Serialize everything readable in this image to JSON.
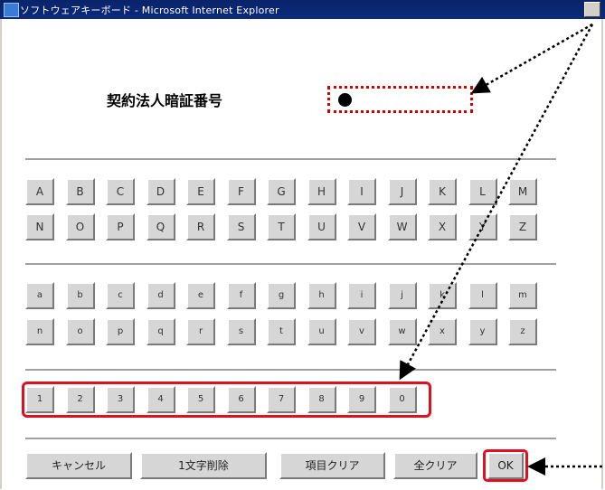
{
  "window": {
    "title": "ソフトウェアキーボード - Microsoft Internet Explorer"
  },
  "field": {
    "label": "契約法人暗証番号"
  },
  "keys": {
    "upper_row1": [
      "A",
      "B",
      "C",
      "D",
      "E",
      "F",
      "G",
      "H",
      "I",
      "J",
      "K",
      "L",
      "M"
    ],
    "upper_row2": [
      "N",
      "O",
      "P",
      "Q",
      "R",
      "S",
      "T",
      "U",
      "V",
      "W",
      "X",
      "Y",
      "Z"
    ],
    "lower_row1": [
      "a",
      "b",
      "c",
      "d",
      "e",
      "f",
      "g",
      "h",
      "i",
      "j",
      "k",
      "l",
      "m"
    ],
    "lower_row2": [
      "n",
      "o",
      "p",
      "q",
      "r",
      "s",
      "t",
      "u",
      "v",
      "w",
      "x",
      "y",
      "z"
    ],
    "digits": [
      "1",
      "2",
      "3",
      "4",
      "5",
      "6",
      "7",
      "8",
      "9",
      "0"
    ]
  },
  "actions": {
    "cancel": "キャンセル",
    "delete_char": "1文字削除",
    "clear_field": "項目クリア",
    "clear_all": "全クリア",
    "ok": "OK"
  },
  "colors": {
    "highlight": "#e01020",
    "titlebar": "#0a246a"
  }
}
